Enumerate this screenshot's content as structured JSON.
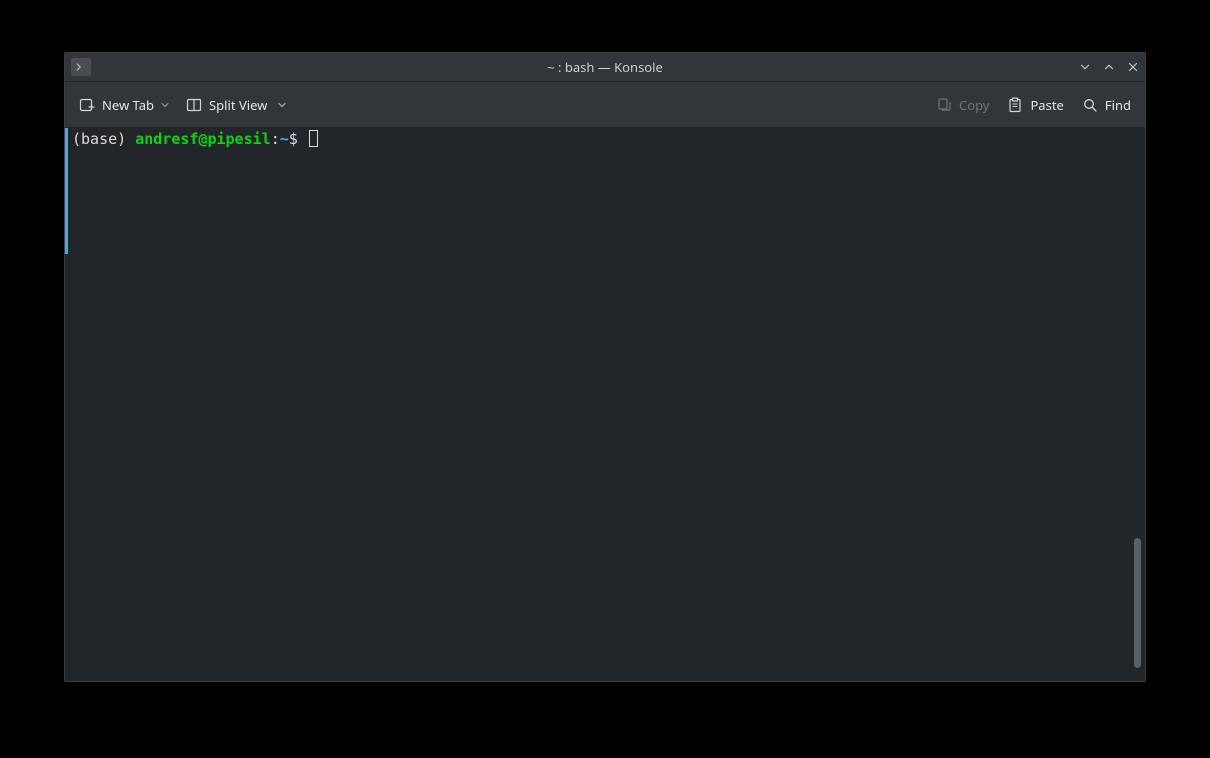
{
  "window": {
    "title": "~ : bash — Konsole"
  },
  "toolbar": {
    "new_tab_label": "New Tab",
    "split_view_label": "Split View",
    "copy_label": "Copy",
    "paste_label": "Paste",
    "find_label": "Find"
  },
  "terminal": {
    "prompt_env": "(base) ",
    "prompt_userhost": "andresf@pipesil",
    "prompt_colon": ":",
    "prompt_path": "~",
    "prompt_symbol": "$ "
  }
}
